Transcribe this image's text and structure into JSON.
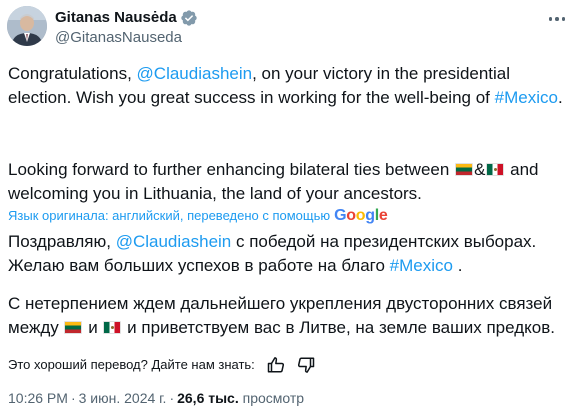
{
  "author": {
    "name": "Gitanas Nausėda",
    "handle": "@GitanasNauseda"
  },
  "original": {
    "p1_pre": "Congratulations, ",
    "p1_mention": "@Claudiashein",
    "p1_mid": ", on your victory in the presidential election. Wish you great success in working for the well-being of ",
    "p1_hashtag": "#Mexico",
    "p1_post": ".",
    "p2_pre": "Looking forward to further enhancing bilateral ties between ",
    "p2_amp": "&",
    "p2_post": " and welcoming you in Lithuania, the land of your ancestors."
  },
  "translation_notice": {
    "text": "Язык оригинала: английский, переведено с помощью",
    "provider": "Google"
  },
  "translated": {
    "p1_pre": "Поздравляю, ",
    "p1_mention": "@Claudiashein",
    "p1_mid": " с победой на президентских выборах. Желаю вам больших успехов в работе на благо ",
    "p1_hashtag": "#Mexico",
    "p1_post": " .",
    "p2_pre": "С нетерпением ждем дальнейшего укрепления двусторонних связей между ",
    "p2_and": " и ",
    "p2_post": " и приветствуем вас в Литве, на земле ваших предков."
  },
  "feedback": {
    "question": "Это хороший перевод? Дайте нам знать:",
    "up_icon": "thumbs-up-icon",
    "down_icon": "thumbs-down-icon"
  },
  "meta": {
    "time": "10:26 PM",
    "separator": "·",
    "date": "3 июн. 2024 г.",
    "views_count": "26,6 тыс.",
    "views_label": "просмотр"
  },
  "colors": {
    "link": "#1d9bf0",
    "text": "#0f1419",
    "secondary": "#536471",
    "verified": "#829aab"
  },
  "icons": {
    "verified": "verified-badge-icon",
    "more": "more-options-icon",
    "flag_lithuania": "lithuania-flag-icon",
    "flag_mexico": "mexico-flag-icon"
  }
}
